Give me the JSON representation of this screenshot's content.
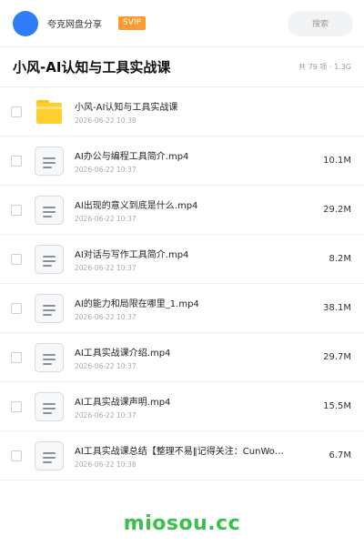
{
  "header": {
    "brand": "夸克网盘分享",
    "badge": "SVIP",
    "search_label": "搜索",
    "avatar_color": "#2e7cf6",
    "badge_color": "#ff9a2e"
  },
  "folder": {
    "title": "小风-AI认知与工具实战课",
    "summary": "共 79 项 · 1.3G"
  },
  "items": [
    {
      "type": "folder",
      "name": "小风-AI认知与工具实战课",
      "date": "2026-06-22 10:38",
      "size": ""
    },
    {
      "type": "file",
      "name": "AI办公与编程工具简介.mp4",
      "date": "2026-06-22 10:37",
      "size": "10.1M"
    },
    {
      "type": "file",
      "name": "AI出现的意义到底是什么.mp4",
      "date": "2026-06-22 10:37",
      "size": "29.2M"
    },
    {
      "type": "file",
      "name": "AI对话与写作工具简介.mp4",
      "date": "2026-06-22 10:37",
      "size": "8.2M"
    },
    {
      "type": "file",
      "name": "AI的能力和局限在哪里_1.mp4",
      "date": "2026-06-22 10:37",
      "size": "38.1M"
    },
    {
      "type": "file",
      "name": "AI工具实战课介绍.mp4",
      "date": "2026-06-22 10:37",
      "size": "29.7M"
    },
    {
      "type": "file",
      "name": "AI工具实战课声明.mp4",
      "date": "2026-06-22 10:37",
      "size": "15.5M"
    },
    {
      "type": "file",
      "name": "AI工具实战课总结【整理不易‖记得关注：CunWo…",
      "date": "2026-06-22 10:38",
      "size": "6.7M"
    }
  ],
  "watermark": "miosou.cc"
}
